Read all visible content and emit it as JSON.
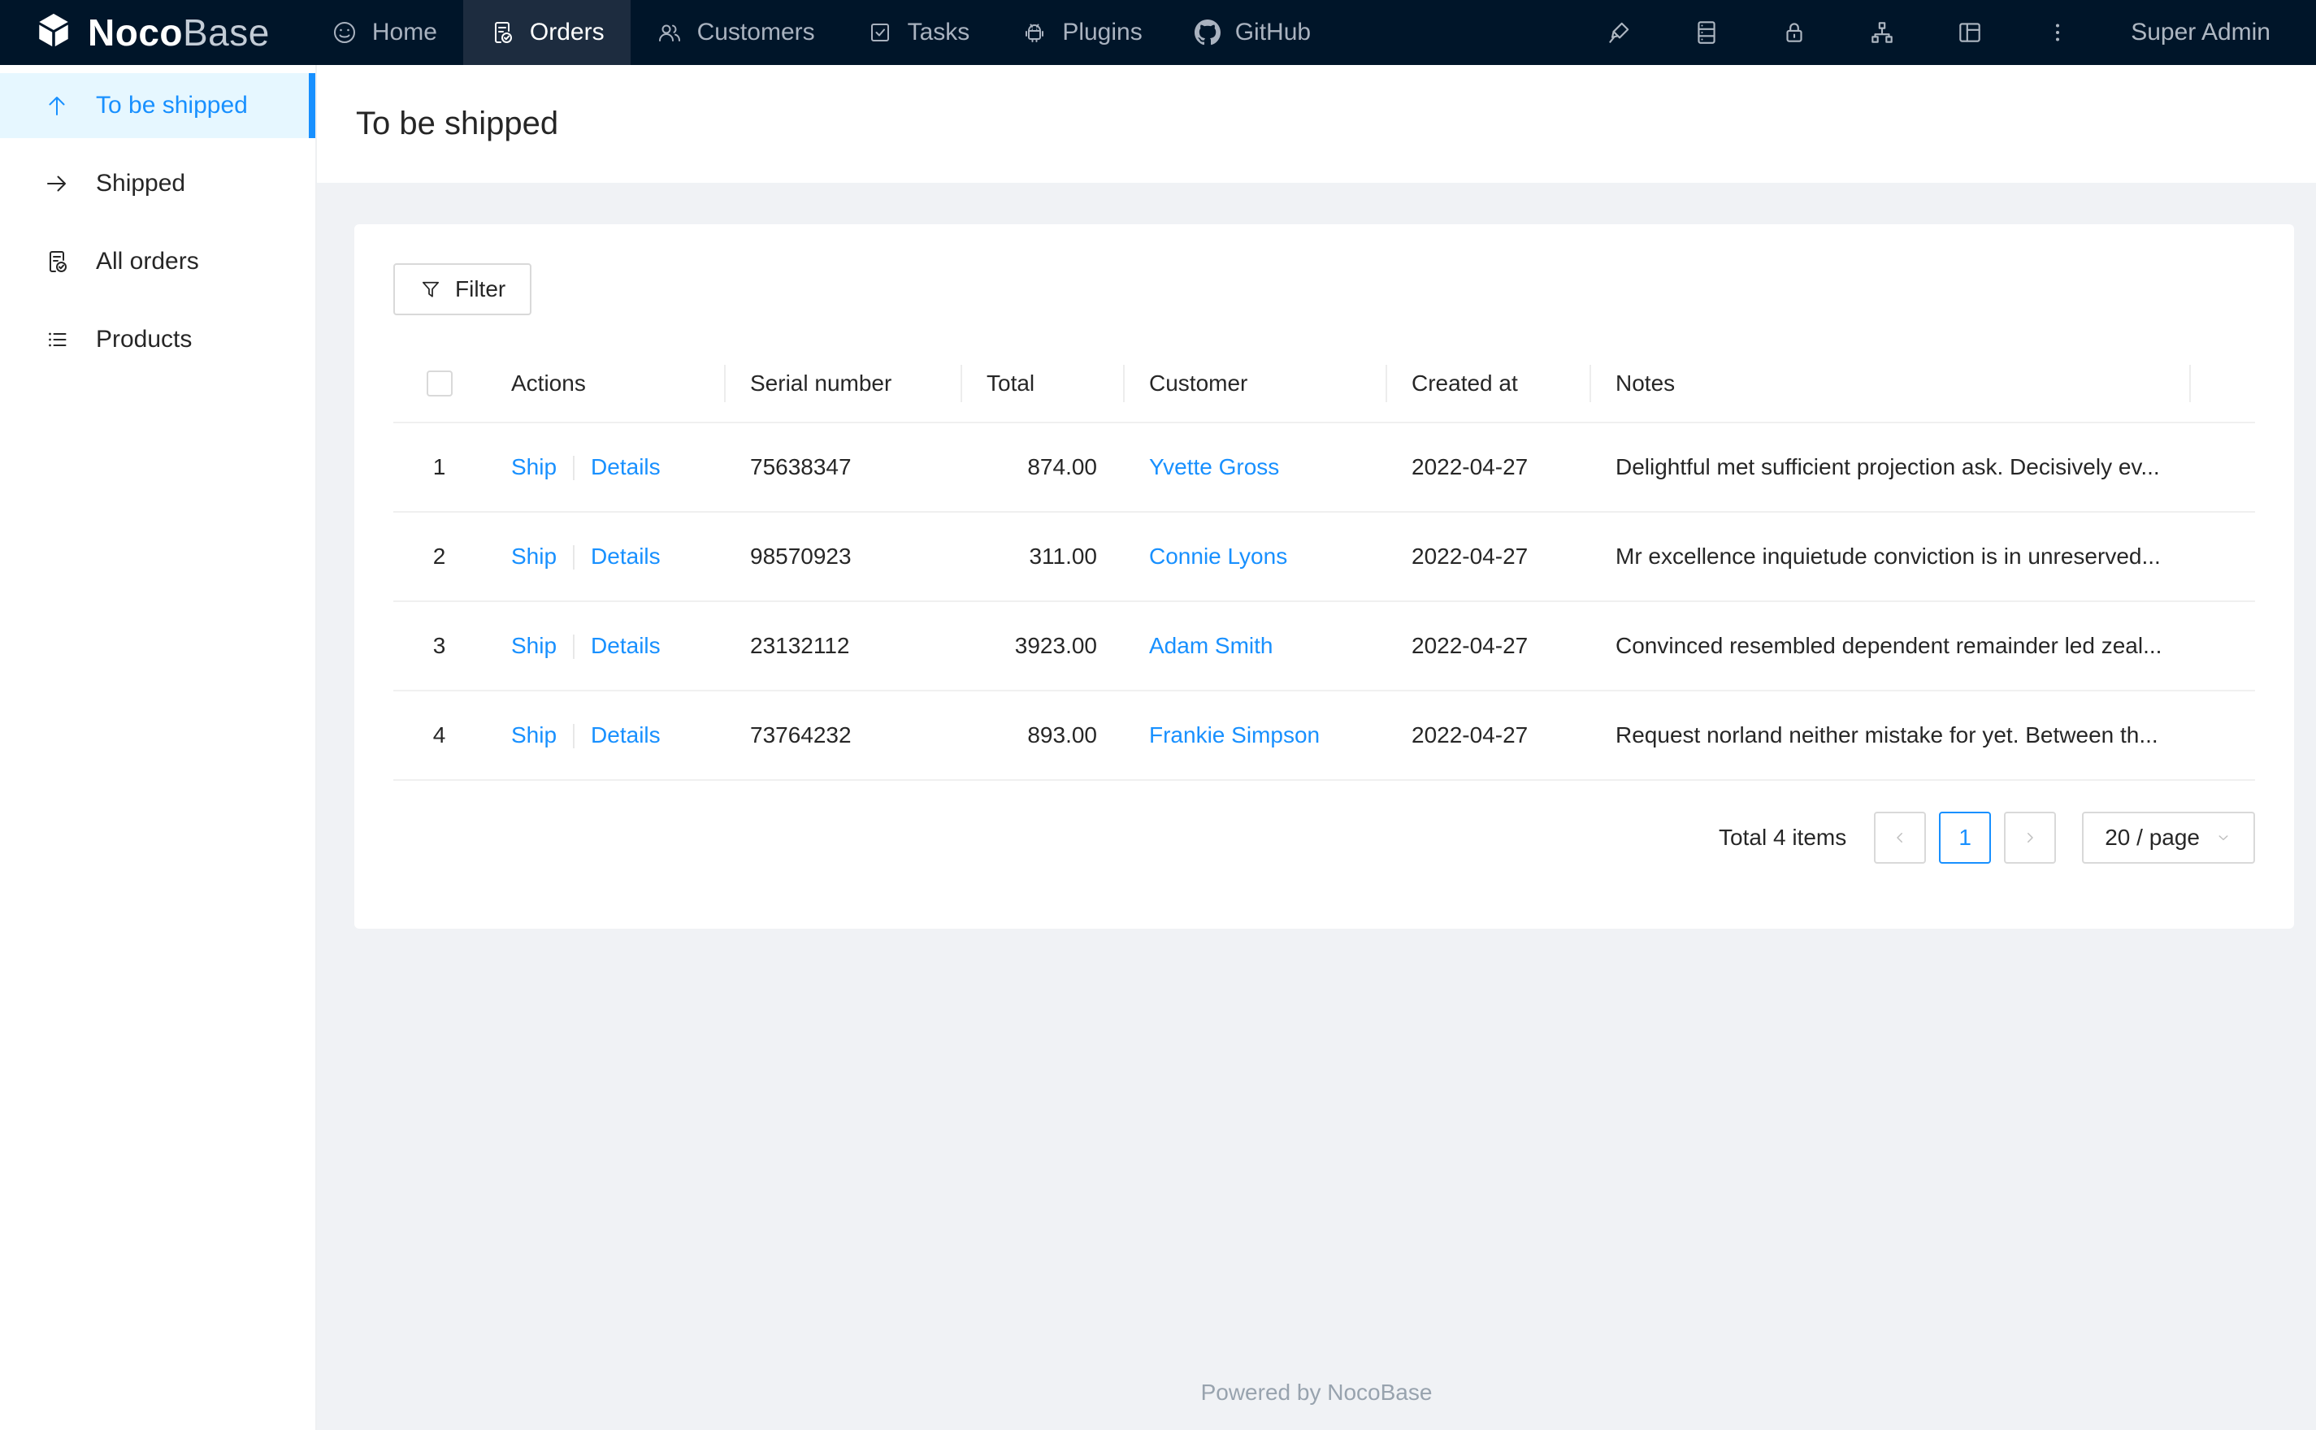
{
  "navbar": {
    "logo": {
      "icon": "nocobase-logo-icon",
      "text_bold": "Noco",
      "text_light": "Base"
    },
    "items": [
      {
        "label": "Home",
        "icon": "smile-icon",
        "active": false
      },
      {
        "label": "Orders",
        "icon": "file-done-icon",
        "active": true
      },
      {
        "label": "Customers",
        "icon": "team-icon",
        "active": false
      },
      {
        "label": "Tasks",
        "icon": "check-square-icon",
        "active": false
      },
      {
        "label": "Plugins",
        "icon": "android-icon",
        "active": false
      },
      {
        "label": "GitHub",
        "icon": "github-icon",
        "active": false
      }
    ],
    "right_icons": [
      "highlight-icon",
      "database-icon",
      "lock-icon",
      "apartment-icon",
      "layout-icon",
      "more-icon"
    ],
    "user": "Super Admin"
  },
  "sidebar": {
    "items": [
      {
        "label": "To be shipped",
        "icon": "arrow-up-icon",
        "active": true
      },
      {
        "label": "Shipped",
        "icon": "arrow-right-icon",
        "active": false
      },
      {
        "label": "All orders",
        "icon": "file-done-icon",
        "active": false
      },
      {
        "label": "Products",
        "icon": "unordered-list-icon",
        "active": false
      }
    ]
  },
  "page": {
    "title": "To be shipped"
  },
  "toolbar": {
    "filter_label": "Filter",
    "filter_icon": "funnel-icon"
  },
  "table": {
    "columns": [
      "Actions",
      "Serial number",
      "Total",
      "Customer",
      "Created at",
      "Notes"
    ],
    "action_labels": [
      "Ship",
      "Details"
    ],
    "rows": [
      {
        "index": "1",
        "serial": "75638347",
        "total": "874.00",
        "customer": "Yvette Gross",
        "created_at": "2022-04-27",
        "notes": "Delightful met sufficient projection ask. Decisively ev..."
      },
      {
        "index": "2",
        "serial": "98570923",
        "total": "311.00",
        "customer": "Connie Lyons",
        "created_at": "2022-04-27",
        "notes": "Mr excellence inquietude conviction is in unreserved..."
      },
      {
        "index": "3",
        "serial": "23132112",
        "total": "3923.00",
        "customer": "Adam Smith",
        "created_at": "2022-04-27",
        "notes": "Convinced resembled dependent remainder led zeal..."
      },
      {
        "index": "4",
        "serial": "73764232",
        "total": "893.00",
        "customer": "Frankie Simpson",
        "created_at": "2022-04-27",
        "notes": "Request norland neither mistake for yet. Between th..."
      }
    ]
  },
  "pagination": {
    "total_text": "Total 4 items",
    "current_page": "1",
    "page_size": "20 / page"
  },
  "footer": {
    "text": "Powered by NocoBase"
  },
  "colors": {
    "accent": "#1890ff",
    "navbar_bg": "#001529",
    "navbar_active_bg": "#1d2c3f",
    "sidebar_active_bg": "#e6f7ff",
    "content_bg": "#f0f2f5",
    "link": "#1890ff"
  }
}
